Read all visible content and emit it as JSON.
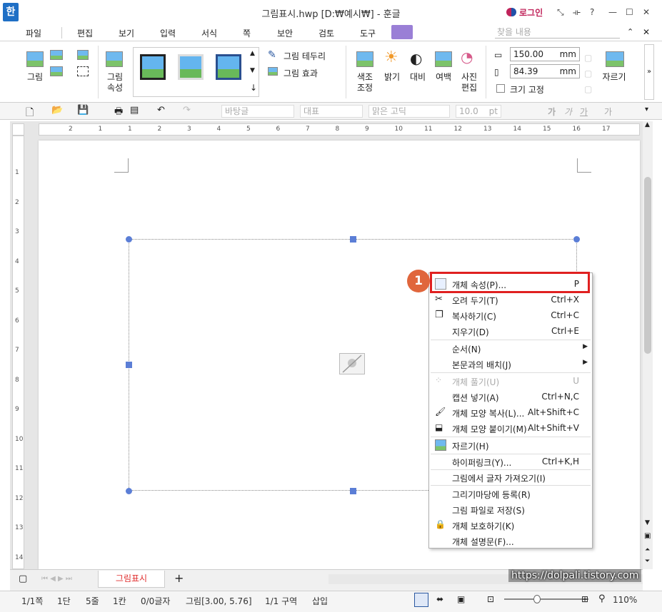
{
  "window": {
    "logo": "한",
    "title": "그림표시.hwp [D:₩예시₩] - 훈글",
    "login": "로그인",
    "controls": [
      "⤡",
      "⟛",
      "?",
      "—",
      "☐",
      "✕"
    ]
  },
  "menu": {
    "items": [
      "파일",
      "편집",
      "보기",
      "입력",
      "서식",
      "쪽",
      "보안",
      "검토",
      "도구"
    ],
    "search_placeholder": "찾을 내용"
  },
  "ribbon": {
    "picture": "그림",
    "picture_props_1": "그림",
    "picture_props_2": "속성",
    "border": "그림 테두리",
    "effect": "그림 효과",
    "color_adjust_1": "색조",
    "color_adjust_2": "조정",
    "brightness": "밝기",
    "contrast": "대비",
    "margin": "여백",
    "photo_edit_1": "사진",
    "photo_edit_2": "편집",
    "width_value": "150.00",
    "height_value": "84.39",
    "unit": "mm",
    "lock_size": "크기 고정",
    "crop": "자르기"
  },
  "toolbar": {
    "style_combo": "바탕글",
    "rep_combo": "대표",
    "font_combo": "맑은 고딕",
    "size_combo": "10.0",
    "size_unit": "pt",
    "format_buttons": [
      "가",
      "가",
      "가",
      "가"
    ]
  },
  "ruler": {
    "h_numbers": [
      "2",
      "1",
      "1",
      "2",
      "3",
      "4",
      "5",
      "6",
      "7",
      "8",
      "9",
      "10",
      "11",
      "12",
      "13",
      "14",
      "15",
      "16",
      "17"
    ],
    "v_numbers": [
      "1",
      "2",
      "3",
      "4",
      "5",
      "6",
      "7",
      "8",
      "9",
      "10",
      "11",
      "12",
      "13",
      "14"
    ]
  },
  "context_menu": {
    "badge": "1",
    "items": [
      {
        "label": "개체 속성(P)...",
        "shortcut": "P"
      },
      {
        "label": "오려 두기(T)",
        "shortcut": "Ctrl+X"
      },
      {
        "label": "복사하기(C)",
        "shortcut": "Ctrl+C"
      },
      {
        "label": "지우기(D)",
        "shortcut": "Ctrl+E"
      },
      {
        "label": "순서(N)",
        "shortcut": ""
      },
      {
        "label": "본문과의 배치(J)",
        "shortcut": ""
      },
      {
        "label": "개체 풀기(U)",
        "shortcut": "U"
      },
      {
        "label": "캡션 넣기(A)",
        "shortcut": "Ctrl+N,C"
      },
      {
        "label": "개체 모양 복사(L)...",
        "shortcut": "Alt+Shift+C"
      },
      {
        "label": "개체 모양 붙이기(M)",
        "shortcut": "Alt+Shift+V"
      },
      {
        "label": "자르기(H)",
        "shortcut": ""
      },
      {
        "label": "하이퍼링크(Y)...",
        "shortcut": "Ctrl+K,H"
      },
      {
        "label": "그림에서 글자 가져오기(I)",
        "shortcut": ""
      },
      {
        "label": "그리기마당에 등록(R)",
        "shortcut": ""
      },
      {
        "label": "그림 파일로 저장(S)",
        "shortcut": ""
      },
      {
        "label": "개체 보호하기(K)",
        "shortcut": ""
      },
      {
        "label": "개체 설명문(F)...",
        "shortcut": ""
      }
    ]
  },
  "tabs": {
    "sheet": "그림표시",
    "add": "+"
  },
  "watermark": "https://dolpali.tistory.com",
  "status": {
    "page": "1/1쪽",
    "column": "1단",
    "line": "5줄",
    "col": "1칸",
    "chars": "0/0글자",
    "object": "그림[3.00, 5.76]",
    "section": "1/1 구역",
    "mode": "삽입",
    "zoom": "110%"
  },
  "colors": {
    "accent": "#1f6fc5",
    "highlight": "#e02020",
    "badge": "#e0663c",
    "handle": "#5b7ed6"
  }
}
